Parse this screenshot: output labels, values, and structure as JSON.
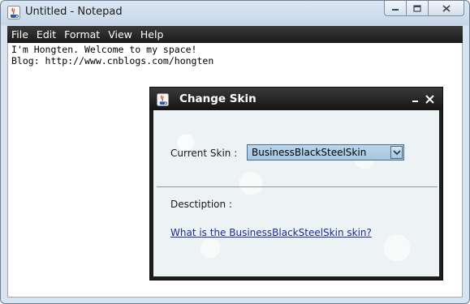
{
  "window": {
    "title": "Untitled - Notepad",
    "icon": "java-cup-icon"
  },
  "caption_buttons": [
    "minimize-icon",
    "maximize-icon",
    "close-icon"
  ],
  "menu": [
    "File",
    "Edit",
    "Format",
    "View",
    "Help"
  ],
  "editor": {
    "lines": [
      "I'm Hongten. Welcome to my space!",
      "Blog: http://www.cnblogs.com/hongten"
    ]
  },
  "dialog": {
    "title": "Change Skin",
    "icon": "java-cup-icon",
    "current_skin_label": "Current Skin :",
    "current_skin_value": "BusinessBlackSteelSkin",
    "description_label": "Desctiption :",
    "link_text": "What is the BusinessBlackSteelSkin skin?"
  },
  "colors": {
    "menubar": "#1b1b1b",
    "dialog_title": "#141414",
    "link": "#1a2a9c",
    "combo": "#a6c6e0"
  }
}
